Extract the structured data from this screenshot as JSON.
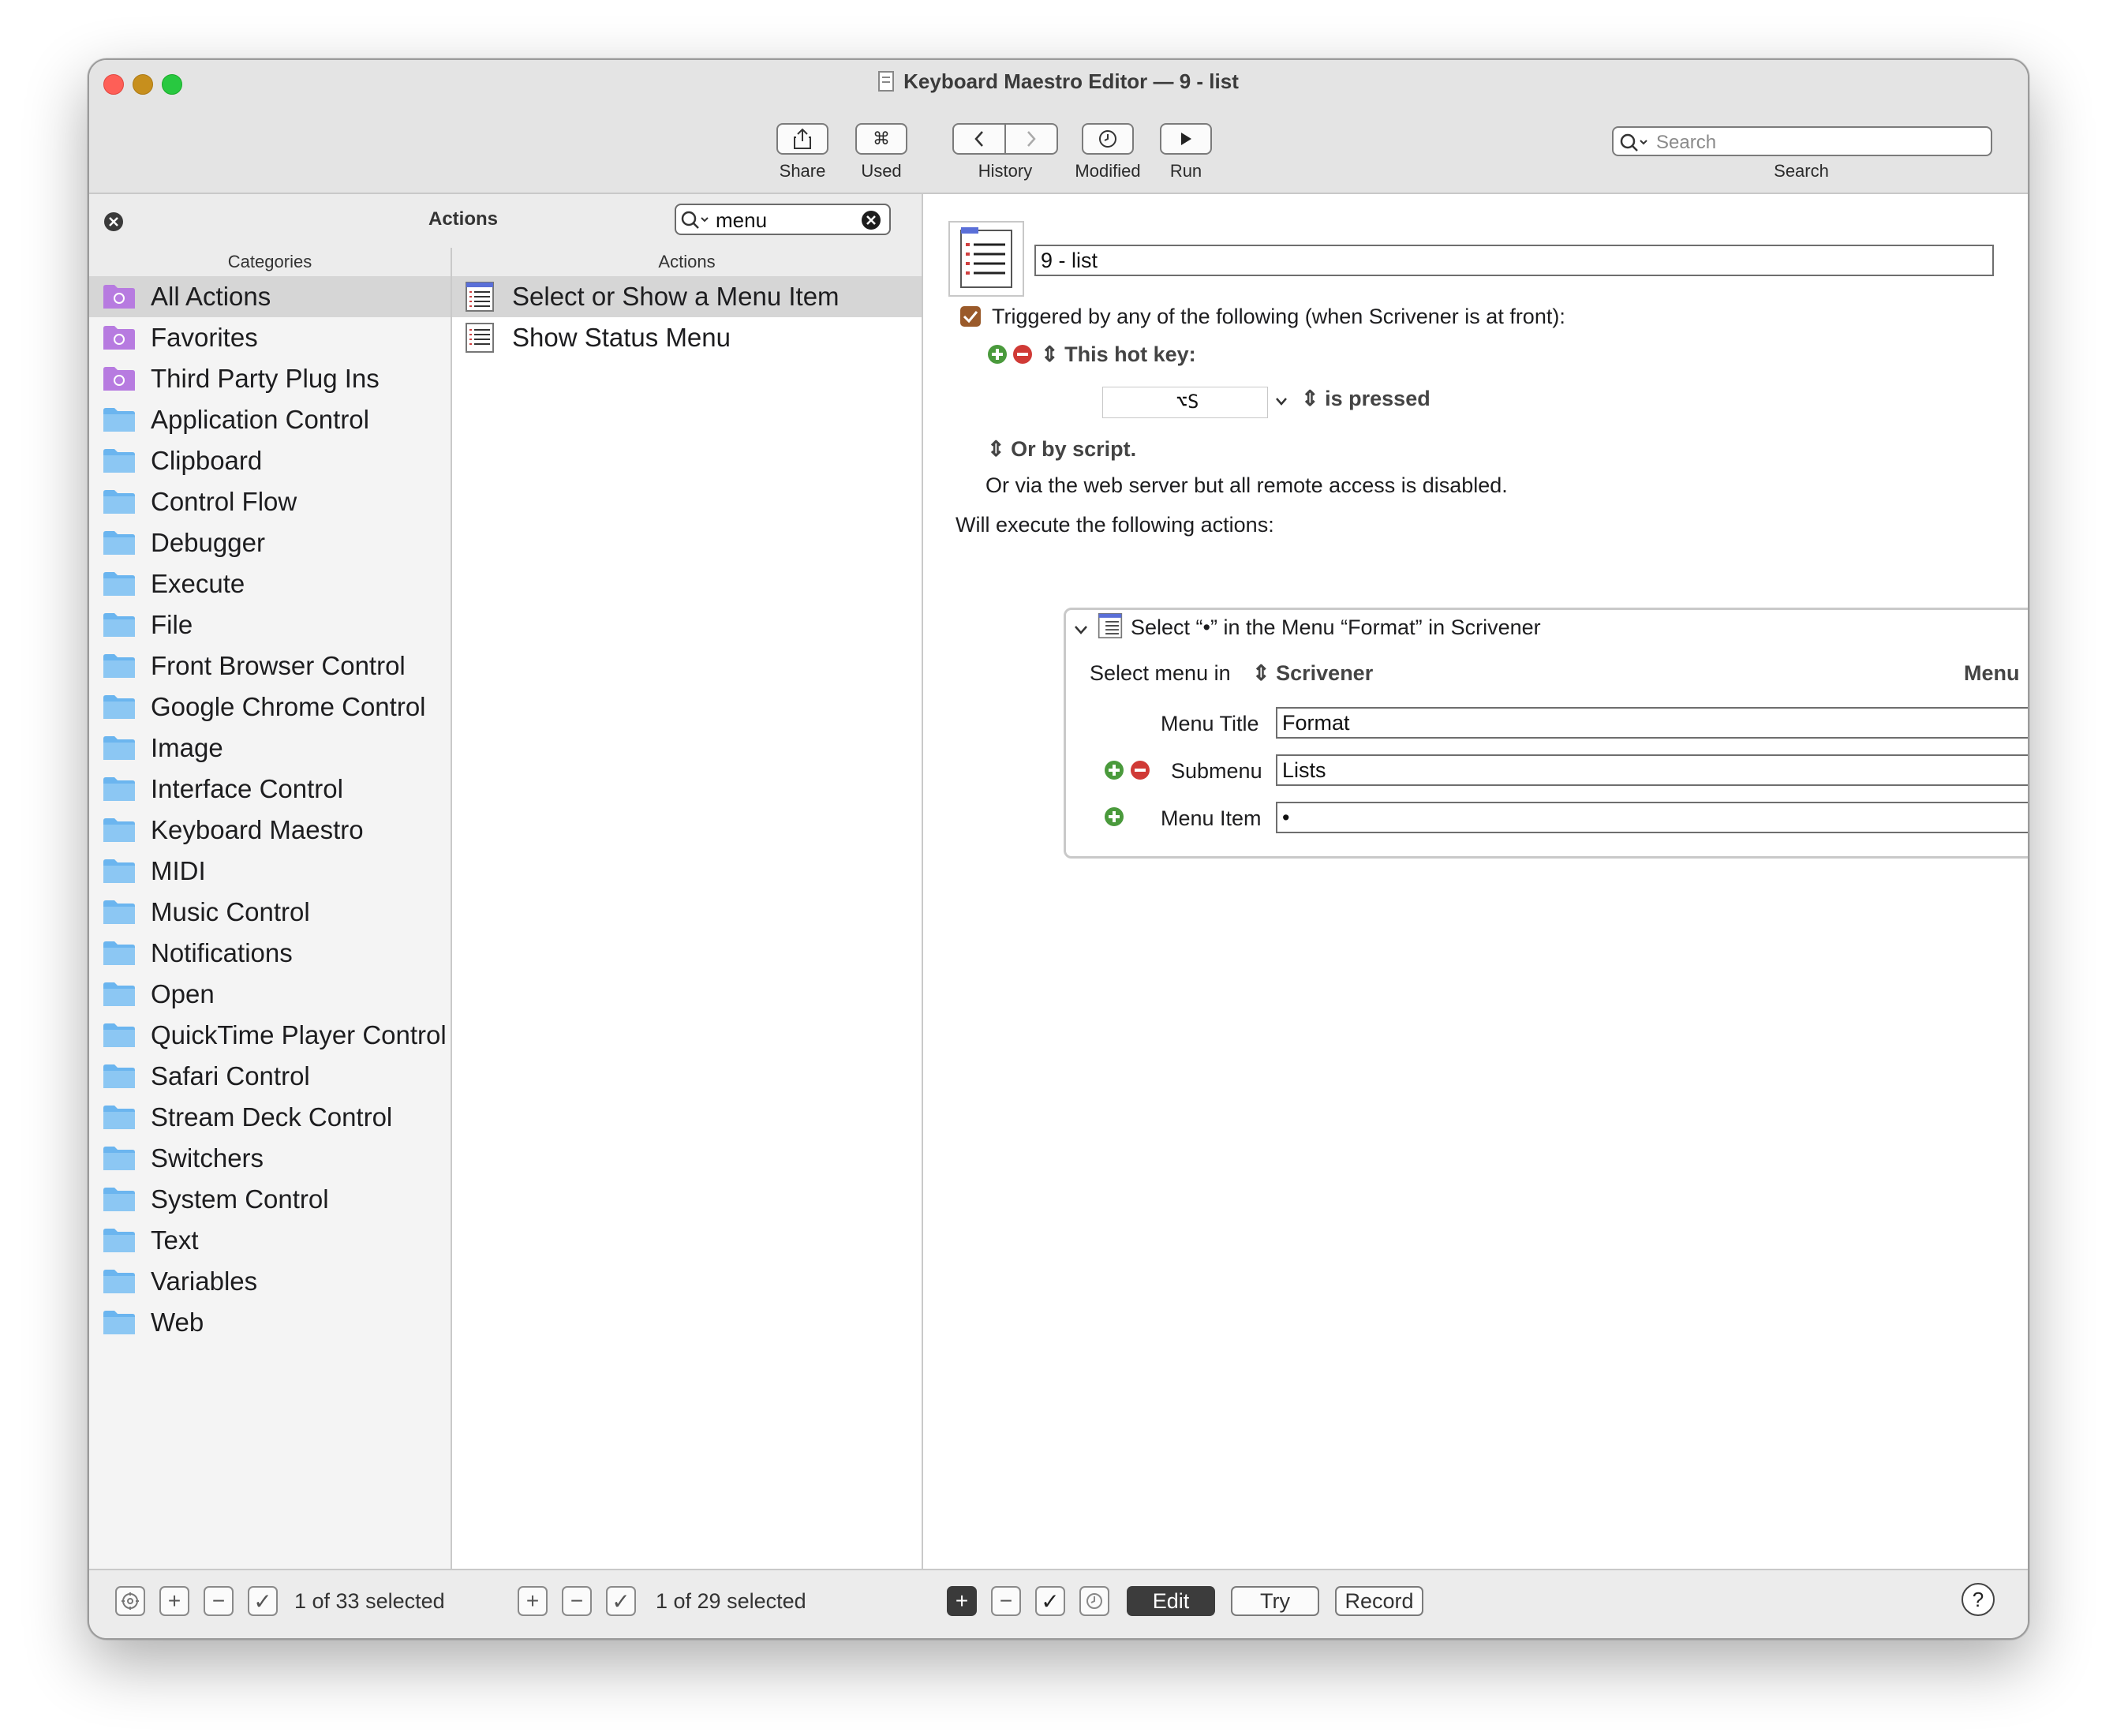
{
  "window": {
    "title": "Keyboard Maestro Editor — 9 - list"
  },
  "toolbar": {
    "share": "Share",
    "used": "Used",
    "used_glyph": "⌘",
    "history": "History",
    "modified": "Modified",
    "run": "Run",
    "search_placeholder": "Search",
    "search_label": "Search"
  },
  "left_panel": {
    "header": "Actions",
    "search_value": "menu",
    "categories_header": "Categories",
    "actions_header": "Actions",
    "categories": [
      "All Actions",
      "Favorites",
      "Third Party Plug Ins",
      "Application Control",
      "Clipboard",
      "Control Flow",
      "Debugger",
      "Execute",
      "File",
      "Front Browser Control",
      "Google Chrome Control",
      "Image",
      "Interface Control",
      "Keyboard Maestro",
      "MIDI",
      "Music Control",
      "Notifications",
      "Open",
      "QuickTime Player Control",
      "Safari Control",
      "Stream Deck Control",
      "Switchers",
      "System Control",
      "Text",
      "Variables",
      "Web"
    ],
    "actions": [
      "Select or Show a Menu Item",
      "Show Status Menu"
    ]
  },
  "macro": {
    "name": "9 - list",
    "trigger_text": "Triggered by any of the following (when Scrivener is at front):",
    "hotkey_label": "This hot key:",
    "hotkey_value": "⌥S",
    "hotkey_state": "is pressed",
    "or_script": "Or by script.",
    "web_server": "Or via the web server but all remote access is disabled.",
    "will_execute": "Will execute the following actions:"
  },
  "action": {
    "title": "Select “•” in the Menu “Format” in Scrivener",
    "select_menu_in": "Select menu in",
    "app": "Scrivener",
    "menu_dropdown": "Menu",
    "menu_title_label": "Menu Title",
    "menu_title_value": "Format",
    "submenu_label": "Submenu",
    "submenu_value": "Lists",
    "menu_item_label": "Menu Item",
    "menu_item_value": "•"
  },
  "footer": {
    "categories_status": "1 of 33 selected",
    "actions_status": "1 of 29 selected",
    "edit": "Edit",
    "try": "Try",
    "record": "Record",
    "help": "?"
  },
  "colors": {
    "folder_blue": "#6bb5ef",
    "smart_folder_purple": "#b77be0",
    "checkbox_brown": "#9a5a2a"
  }
}
